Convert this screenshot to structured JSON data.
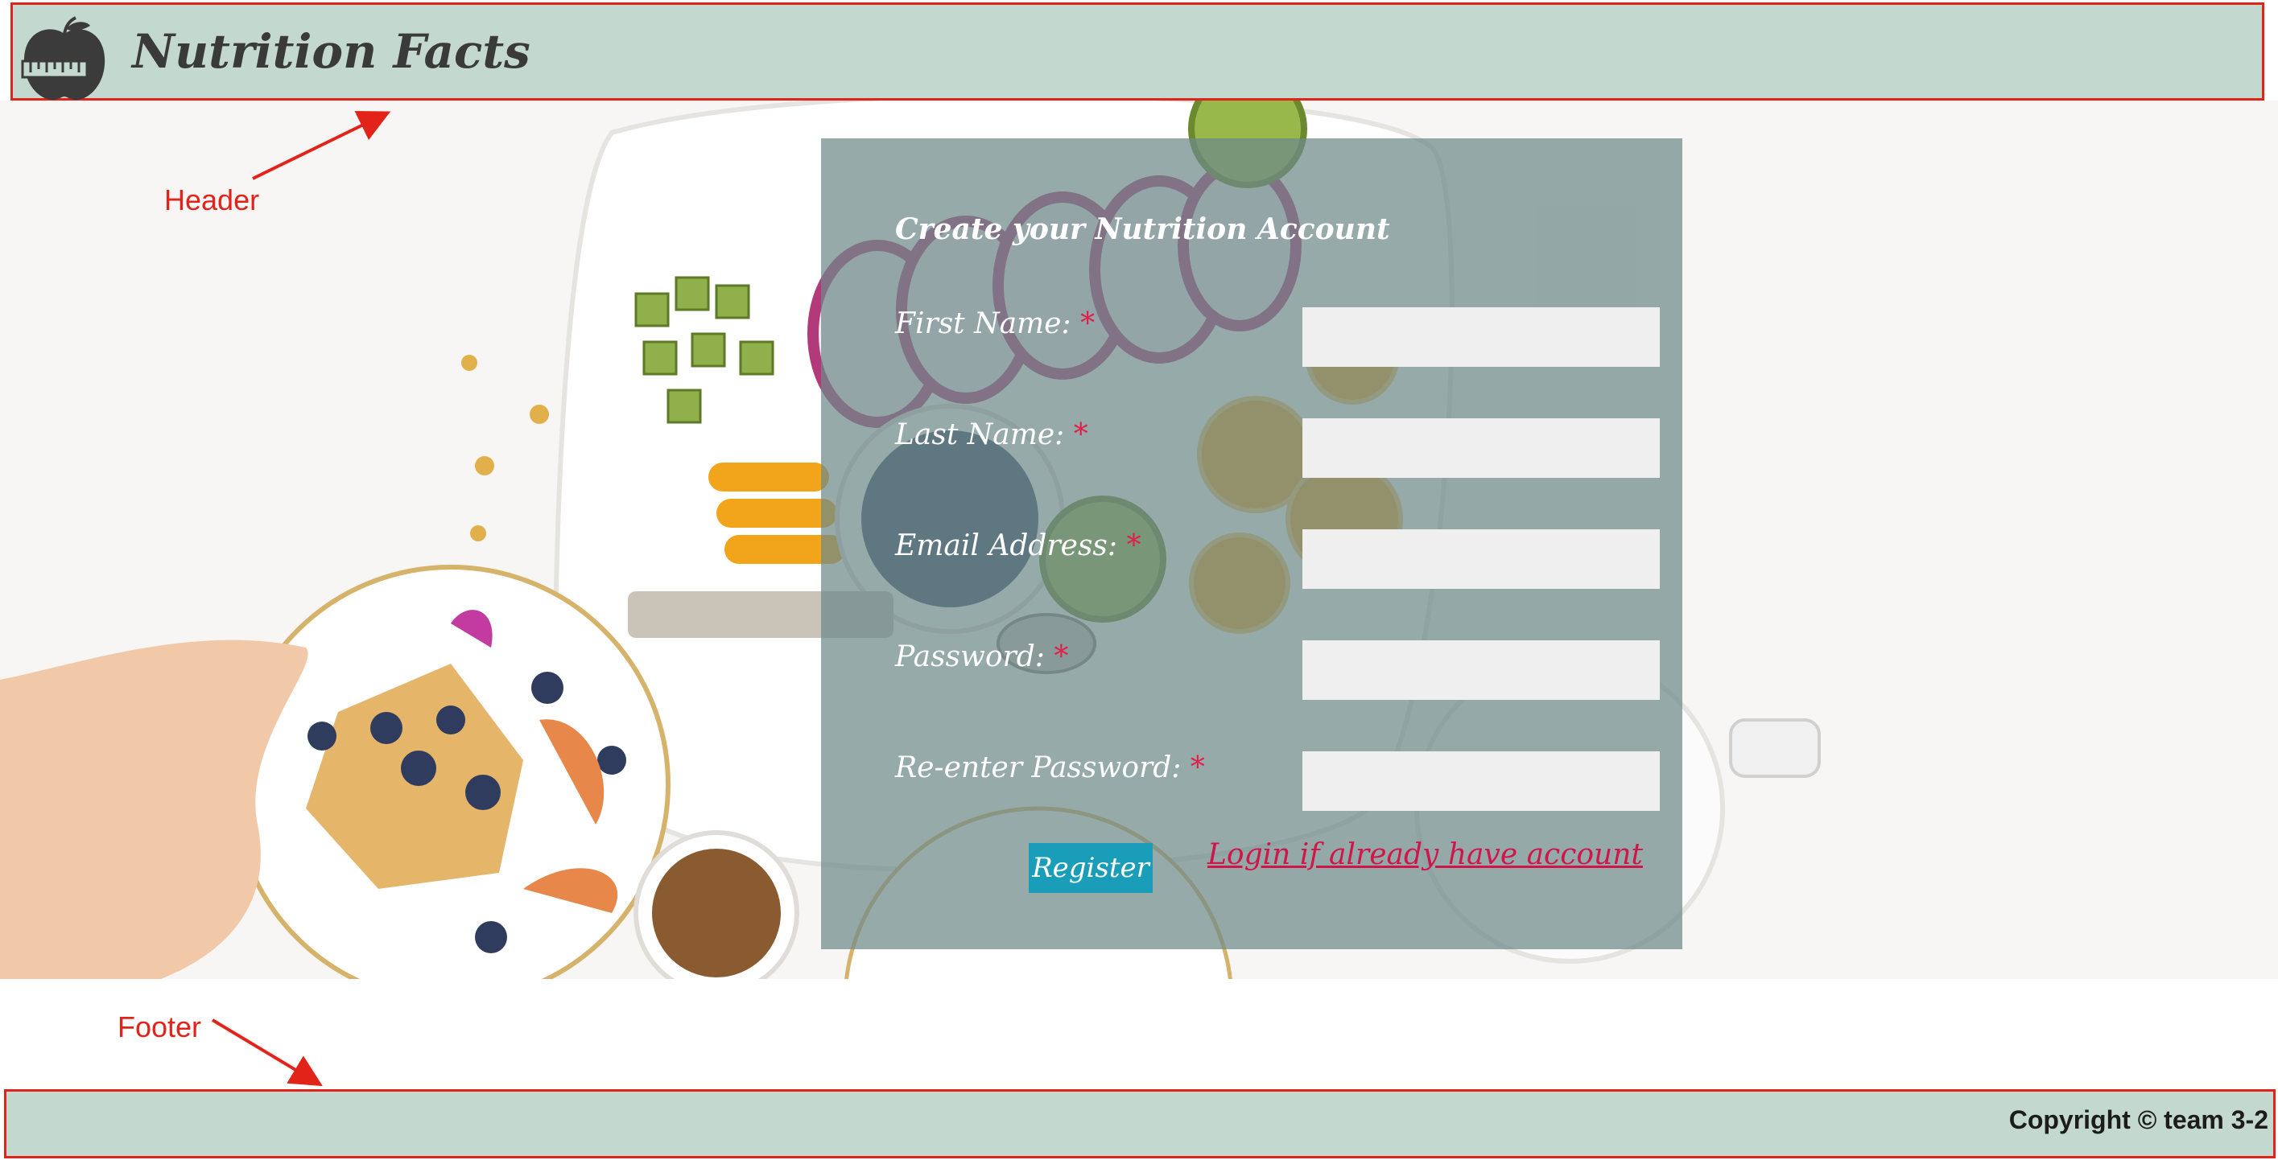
{
  "header": {
    "title": "Nutrition Facts",
    "logo_icon": "apple-scale-icon"
  },
  "form": {
    "title": "Create your Nutrition Account",
    "required_marker": "*",
    "fields": [
      {
        "label": "First Name:",
        "value": ""
      },
      {
        "label": "Last Name:",
        "value": ""
      },
      {
        "label": "Email Address:",
        "value": ""
      },
      {
        "label": "Password:",
        "value": ""
      },
      {
        "label": "Re-enter Password:",
        "value": ""
      }
    ],
    "register_label": "Register",
    "login_link": "Login if already have account"
  },
  "annotations": {
    "header": "Header",
    "footer": "Footer"
  },
  "footer": {
    "copyright": "Copyright © team 3-2"
  },
  "colors": {
    "bar": "#c3d8cf",
    "outline": "#e2231a",
    "panel": "#6e8989",
    "input": "#efefef",
    "button": "#1a9db8",
    "link": "#d0154a",
    "required": "#e0204a"
  }
}
